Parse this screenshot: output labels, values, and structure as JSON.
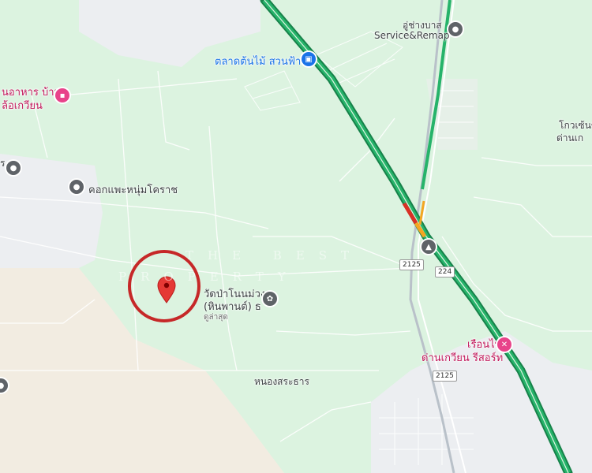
{
  "map": {
    "labels": {
      "restaurant_line1": "นอาหาร บ้าน",
      "restaurant_line2": "ล้อเกวียน",
      "market": "ตลาดต้นไม้ สวนฟ้าใส",
      "service_line1": "อู่ช่างบาส",
      "service_line2": "Service&Remap",
      "farm": "คอกแพะหนุ่มโคราช",
      "temple_line1": "วัดป่าโนนม่วง",
      "temple_line2": "(หินพานต์) ธ",
      "temple_sub": "ดูล่าสุด",
      "village": "หนองสระธาร",
      "resort_line1": "เรือนไทย",
      "resort_line2": "ด่านเกวียน รีสอร์ท",
      "right_line1": "โกวเซ้นข",
      "right_line2": "ด่านเก",
      "left_fragment": "ร"
    },
    "road_shields": {
      "route_2125_upper": "2125",
      "route_224": "224",
      "route_2125_lower": "2125"
    },
    "watermark": {
      "line1": "THE BEST",
      "line2": "PROPERTY"
    },
    "icons": {
      "restaurant": "restaurant-icon",
      "market": "shopping-bag-icon",
      "service": "place-pin-icon",
      "farm": "place-pin-icon",
      "temple": "temple-icon",
      "resort": "resort-icon",
      "education": "graduation-cap-icon",
      "target": "red-map-pin-icon"
    },
    "colors": {
      "land": "#dff5e3",
      "urban": "#eef0f2",
      "sand": "#f3ede2",
      "highway": "#1fa45f",
      "traffic_red": "#d93025",
      "traffic_orange": "#f4a622",
      "pin": "#e53935",
      "circle": "#c62828"
    }
  }
}
